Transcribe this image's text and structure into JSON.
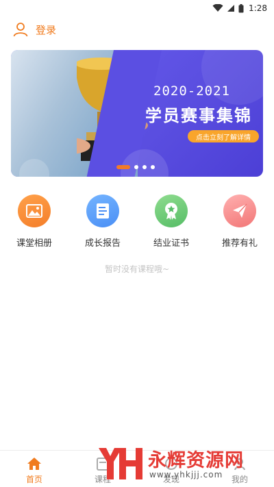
{
  "status_bar": {
    "time": "1:28"
  },
  "header": {
    "login_label": "登录"
  },
  "banner": {
    "year_text": "2020-2021",
    "title": "学员赛事集锦",
    "cta": "点击立刻了解详情",
    "slide_count": 4,
    "active_slide": 1
  },
  "menu": {
    "items": [
      {
        "label": "课堂相册",
        "icon": "photo-album-icon"
      },
      {
        "label": "成长报告",
        "icon": "document-icon"
      },
      {
        "label": "结业证书",
        "icon": "certificate-badge-icon"
      },
      {
        "label": "推荐有礼",
        "icon": "paper-plane-icon"
      }
    ]
  },
  "empty_text": "暂时没有课程哦~",
  "bottom_nav": {
    "items": [
      {
        "label": "首页",
        "icon": "home-icon",
        "active": true
      },
      {
        "label": "课程",
        "icon": "course-icon",
        "active": false
      },
      {
        "label": "发现",
        "icon": "discover-icon",
        "active": false
      },
      {
        "label": "我的",
        "icon": "profile-icon",
        "active": false
      }
    ]
  },
  "watermark": {
    "brand": "永辉资源网",
    "url": "www.yhkjjj.com"
  },
  "colors": {
    "accent": "#f07b1e",
    "banner": "#5a4ee0",
    "cta": "#f9a52b"
  }
}
